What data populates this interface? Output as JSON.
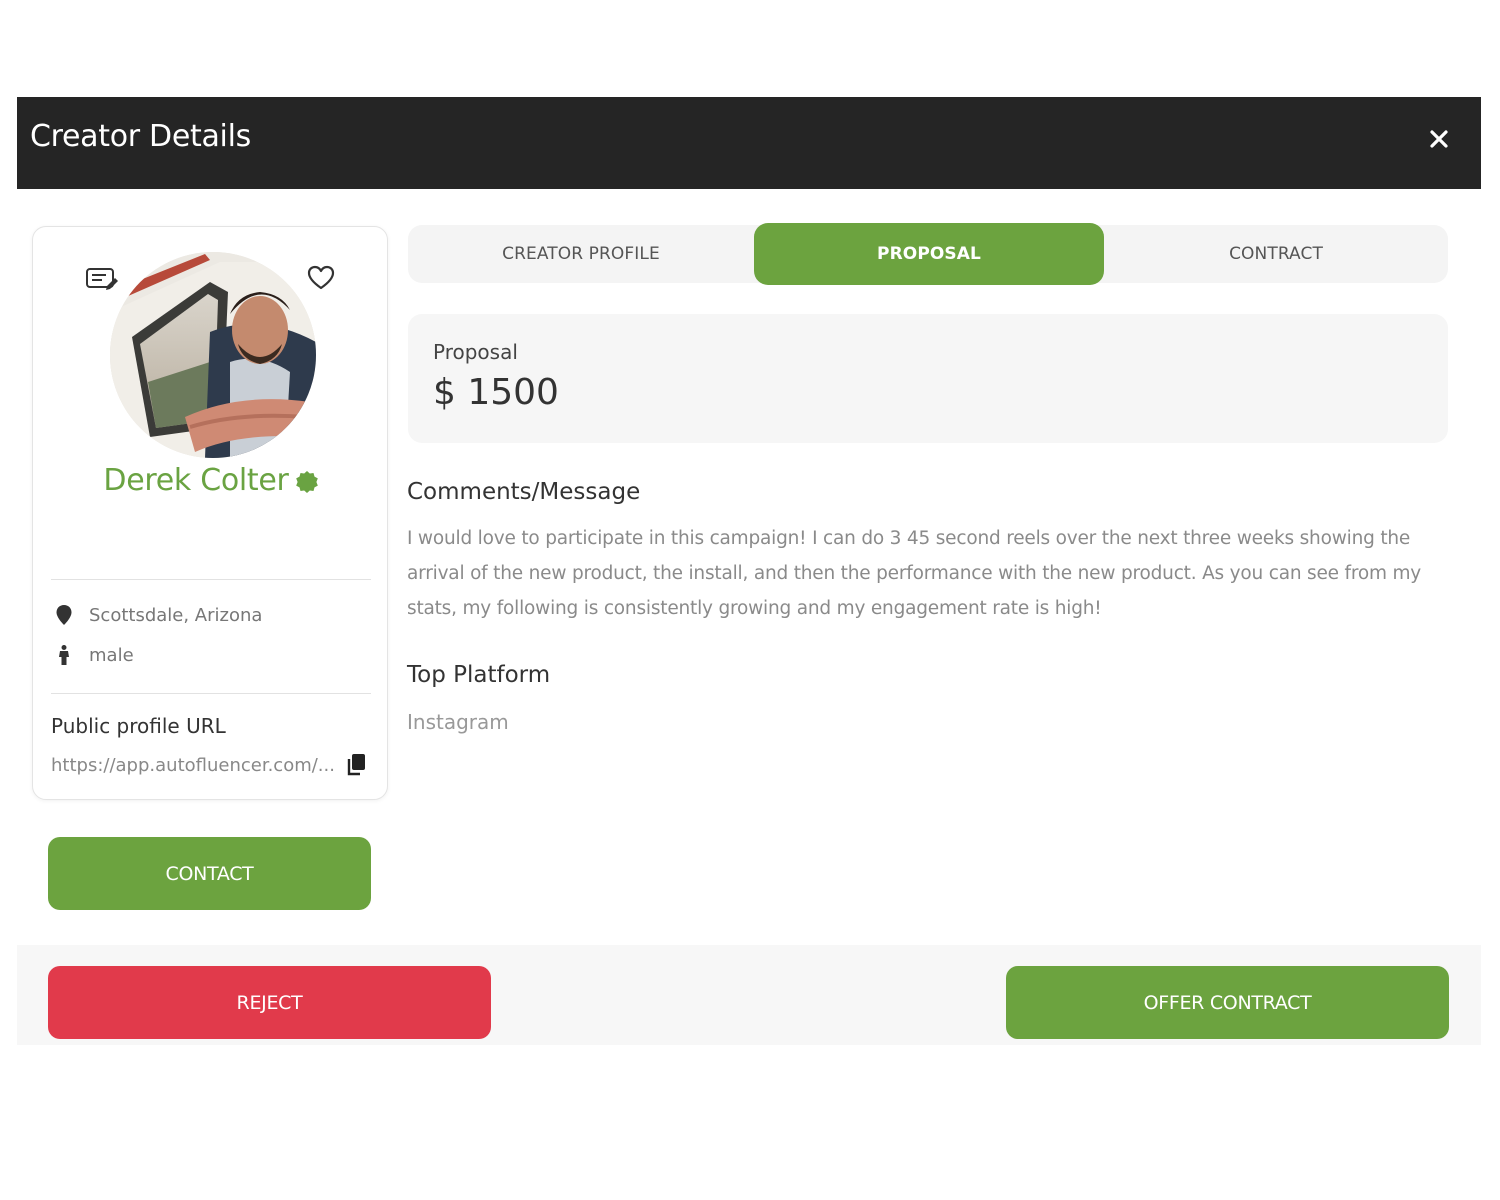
{
  "modal": {
    "title": "Creator Details"
  },
  "creator": {
    "name": "Derek Colter",
    "location": "Scottsdale, Arizona",
    "gender": "male",
    "public_profile_label": "Public profile URL",
    "public_profile_url": "https://app.autofluencer.com/..."
  },
  "buttons": {
    "contact": "CONTACT",
    "reject": "REJECT",
    "offer_contract": "OFFER CONTRACT"
  },
  "tabs": [
    {
      "label": "CREATOR PROFILE",
      "active": false
    },
    {
      "label": "PROPOSAL",
      "active": true
    },
    {
      "label": "CONTRACT",
      "active": false
    }
  ],
  "proposal": {
    "label": "Proposal",
    "amount": "$ 1500"
  },
  "comments": {
    "title": "Comments/Message",
    "text": "I would love to participate in this campaign! I can do 3 45 second reels over the next three weeks showing the arrival of the new product, the install, and then the performance with the new product. As you can see from my stats, my following is consistently growing and my engagement rate is high!"
  },
  "top_platform": {
    "title": "Top Platform",
    "value": "Instagram"
  },
  "colors": {
    "header_bg": "#252525",
    "accent_green": "#6ca33f",
    "reject_red": "#e13a4b",
    "name_green": "#6aa342"
  },
  "icons": [
    "close-icon",
    "notes-icon",
    "heart-icon",
    "verified-badge-icon",
    "location-pin-icon",
    "person-icon",
    "copy-icon"
  ]
}
